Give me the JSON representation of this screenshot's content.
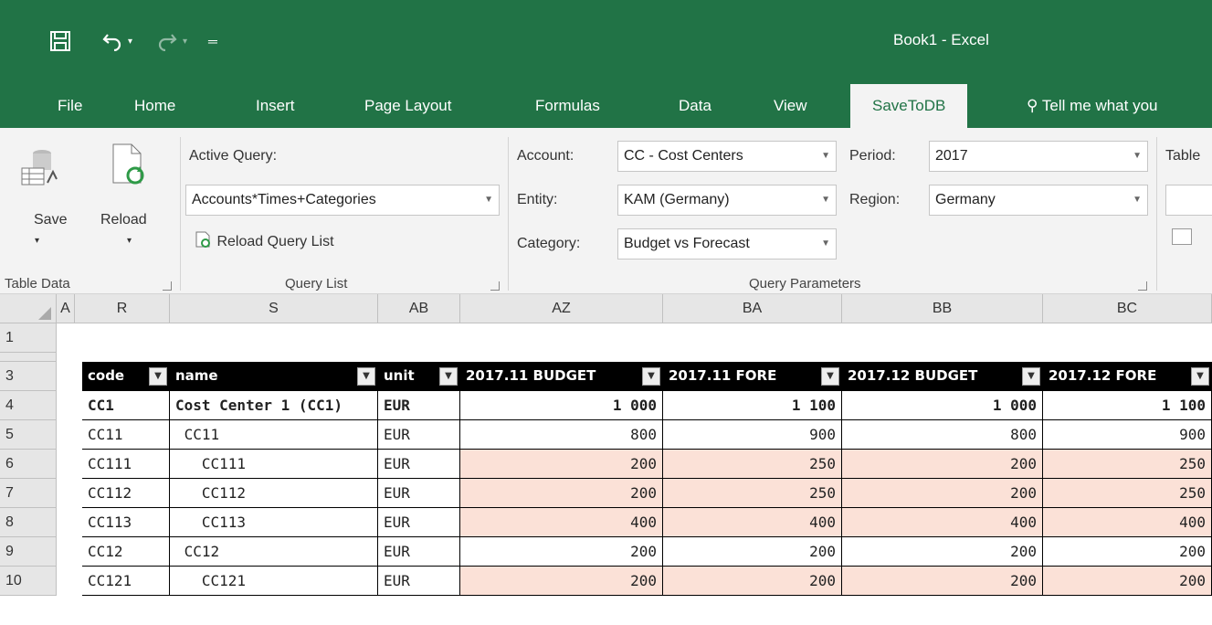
{
  "window": {
    "title": "Book1  -  Excel"
  },
  "quick_access": {
    "save_icon": "save-icon",
    "undo_icon": "undo-icon",
    "redo_icon": "redo-icon",
    "customize_icon": "customize-icon"
  },
  "tabs": [
    {
      "label": "File",
      "active": false
    },
    {
      "label": "Home",
      "active": false
    },
    {
      "label": "Insert",
      "active": false
    },
    {
      "label": "Page Layout",
      "active": false
    },
    {
      "label": "Formulas",
      "active": false
    },
    {
      "label": "Data",
      "active": false
    },
    {
      "label": "View",
      "active": false
    },
    {
      "label": "SaveToDB",
      "active": true
    },
    {
      "label": "Tell me what you",
      "active": false
    }
  ],
  "ribbon": {
    "table_data": {
      "save_label": "Save",
      "reload_label": "Reload",
      "group_label": "Table Data"
    },
    "query_list": {
      "active_query_label": "Active Query:",
      "active_query_value": "Accounts*Times+Categories",
      "reload_list_label": "Reload Query List",
      "group_label": "Query List"
    },
    "query_parameters": {
      "account_label": "Account:",
      "account_value": "CC - Cost Centers",
      "entity_label": "Entity:",
      "entity_value": "KAM (Germany)",
      "category_label": "Category:",
      "category_value": "Budget vs Forecast",
      "period_label": "Period:",
      "period_value": "2017",
      "region_label": "Region:",
      "region_value": "Germany",
      "group_label": "Query Parameters"
    },
    "table_partial_label": "Table"
  },
  "sheet": {
    "column_headers": [
      "A",
      "R",
      "S",
      "AB",
      "AZ",
      "BA",
      "BB",
      "BC"
    ],
    "row_numbers": [
      "1",
      "3",
      "4",
      "5",
      "6",
      "7",
      "8",
      "9",
      "10"
    ],
    "table_headers": [
      "code",
      "name",
      "unit",
      "2017.11 BUDGET",
      "2017.11 FORE",
      "2017.12 BUDGET",
      "2017.12 FORE"
    ],
    "rows": [
      {
        "code": "CC1",
        "name": "Cost Center 1 (CC1)",
        "unit": "EUR",
        "v1": "1 000",
        "v2": "1 100",
        "v3": "1 000",
        "v4": "1 100",
        "bold": true,
        "pink": false
      },
      {
        "code": "CC11",
        "name": " CC11",
        "unit": "EUR",
        "v1": "800",
        "v2": "900",
        "v3": "800",
        "v4": "900",
        "bold": false,
        "pink": false
      },
      {
        "code": "CC111",
        "name": "   CC111",
        "unit": "EUR",
        "v1": "200",
        "v2": "250",
        "v3": "200",
        "v4": "250",
        "bold": false,
        "pink": true
      },
      {
        "code": "CC112",
        "name": "   CC112",
        "unit": "EUR",
        "v1": "200",
        "v2": "250",
        "v3": "200",
        "v4": "250",
        "bold": false,
        "pink": true
      },
      {
        "code": "CC113",
        "name": "   CC113",
        "unit": "EUR",
        "v1": "400",
        "v2": "400",
        "v3": "400",
        "v4": "400",
        "bold": false,
        "pink": true
      },
      {
        "code": "CC12",
        "name": " CC12",
        "unit": "EUR",
        "v1": "200",
        "v2": "200",
        "v3": "200",
        "v4": "200",
        "bold": false,
        "pink": false
      },
      {
        "code": "CC121",
        "name": "   CC121",
        "unit": "EUR",
        "v1": "200",
        "v2": "200",
        "v3": "200",
        "v4": "200",
        "bold": false,
        "pink": true
      }
    ]
  }
}
